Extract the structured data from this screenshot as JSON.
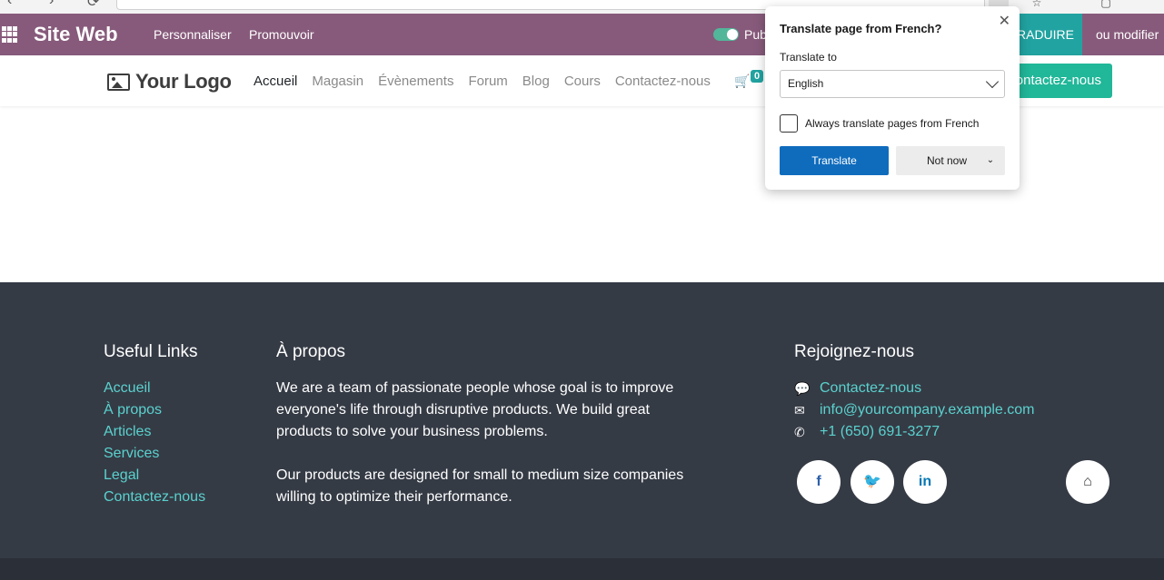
{
  "topbar": {
    "site_title": "Site Web",
    "menu": [
      "Personnaliser",
      "Promouvoir"
    ],
    "publish_label": "Pub",
    "translate_button": "RADUIRE",
    "edit_link": "ou modifier"
  },
  "header": {
    "logo_text": "Your Logo",
    "nav": [
      {
        "label": "Accueil",
        "active": true
      },
      {
        "label": "Magasin"
      },
      {
        "label": "Évènements"
      },
      {
        "label": "Forum"
      },
      {
        "label": "Blog"
      },
      {
        "label": "Cours"
      },
      {
        "label": "Contactez-nous"
      }
    ],
    "cart_count": "0",
    "contact_button": "ontactez-nous"
  },
  "footer": {
    "useful_links": {
      "title": "Useful Links",
      "items": [
        "Accueil",
        "À propos",
        "Articles",
        "Services",
        "Legal",
        "Contactez-nous"
      ]
    },
    "about": {
      "title": "À propos",
      "paragraph1": "We are a team of passionate people whose goal is to improve everyone's life through disruptive products. We build great products to solve your business problems.",
      "paragraph2": "Our products are designed for small to medium size companies willing to optimize their performance."
    },
    "join": {
      "title": "Rejoignez-nous",
      "contact": "Contactez-nous",
      "email": "info@yourcompany.example.com",
      "phone": "+1 (650) 691-3277"
    },
    "social": [
      "f",
      "t",
      "in",
      "home"
    ]
  },
  "popup": {
    "title": "Translate page from French?",
    "translate_to_label": "Translate to",
    "selected_language": "English",
    "always_translate_label": "Always translate pages from French",
    "always_translate_checked": false,
    "translate_button": "Translate",
    "not_now_button": "Not now"
  },
  "colors": {
    "topbar": "#875a7b",
    "accent": "#21a3a1",
    "footer": "#353b45",
    "link": "#5ad2cf",
    "primary_button": "#0f6cbd"
  }
}
